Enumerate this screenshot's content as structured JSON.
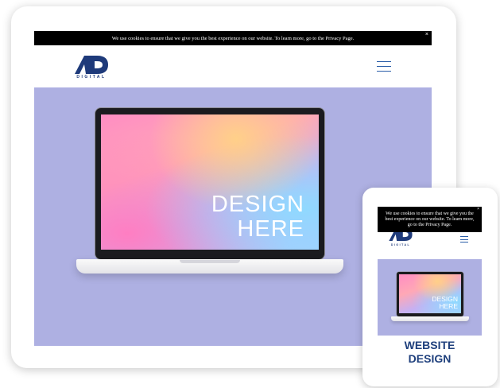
{
  "tablet": {
    "cookie_text": "We use cookies to ensure that we give you the best experience on our website. To learn more, go to the Privacy Page.",
    "close_label": "×",
    "logo_text": "DIGITAL",
    "display_line1": "DESIGN",
    "display_line2": "HERE"
  },
  "phone": {
    "cookie_text": "We use cookies to ensure that we give you the best experience on our website. To learn more, go to the Privacy Page.",
    "close_label": "×",
    "logo_text": "DIGITAL",
    "display_line1": "DESIGN",
    "display_line2": "HERE",
    "heading_line1": "WEBSITE",
    "heading_line2": "DESIGN"
  },
  "colors": {
    "brand_navy": "#1e3a7a",
    "menu_blue": "#2a5da8",
    "hero_bg": "#aeb0e2",
    "cookie_bg": "#000000"
  },
  "icons": {
    "menu": "hamburger-icon",
    "close": "close-icon",
    "logo": "ad-logo-icon"
  }
}
